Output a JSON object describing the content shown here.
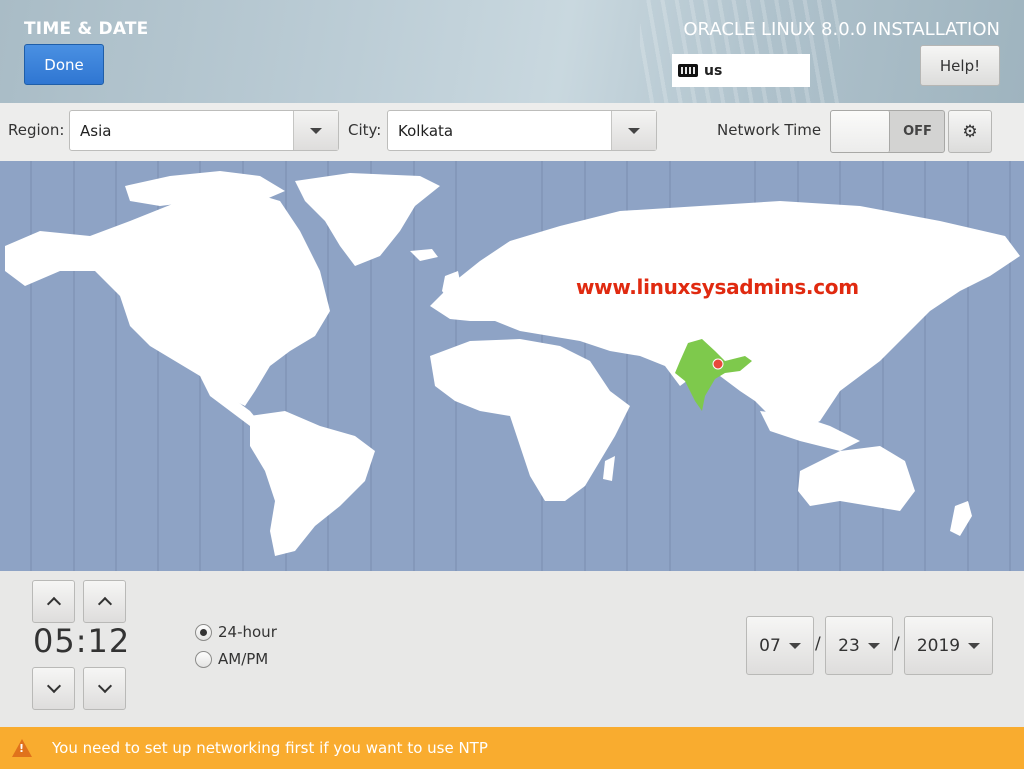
{
  "header": {
    "title": "TIME & DATE",
    "done_label": "Done",
    "product": "ORACLE LINUX 8.0.0 INSTALLATION",
    "keyboard_layout": "us",
    "help_label": "Help!"
  },
  "toolbar": {
    "region_label": "Region:",
    "region_value": "Asia",
    "city_label": "City:",
    "city_value": "Kolkata",
    "network_time_label": "Network Time",
    "network_time_state": "OFF"
  },
  "map": {
    "watermark": "www.linuxsysadmins.com",
    "highlighted_country": "India",
    "selected_city": "Kolkata",
    "colors": {
      "ocean": "#8ea3c5",
      "land": "#ffffff",
      "highlight": "#7ec94c",
      "pin": "#e8483a"
    }
  },
  "time": {
    "value": "05:12",
    "format_options": [
      {
        "label": "24-hour",
        "selected": true
      },
      {
        "label": "AM/PM",
        "selected": false
      }
    ]
  },
  "date": {
    "month": "07",
    "day": "23",
    "year": "2019",
    "separator": "/"
  },
  "warning": {
    "text": "You need to set up networking first if you want to use NTP",
    "color": "#f9ac2f"
  }
}
